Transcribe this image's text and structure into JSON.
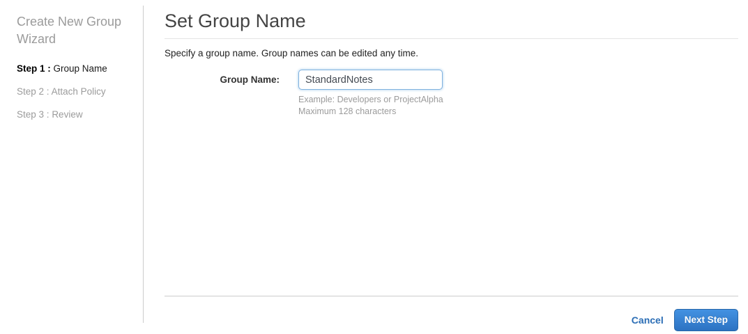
{
  "sidebar": {
    "title": "Create New Group Wizard",
    "steps": [
      {
        "prefix": "Step 1 :",
        "label": "Group Name",
        "active": true
      },
      {
        "prefix": "Step 2 :",
        "label": "Attach Policy",
        "active": false
      },
      {
        "prefix": "Step 3 :",
        "label": "Review",
        "active": false
      }
    ]
  },
  "main": {
    "title": "Set Group Name",
    "description": "Specify a group name. Group names can be edited any time.",
    "form": {
      "label": "Group Name:",
      "value": "StandardNotes",
      "hint_example": "Example: Developers or ProjectAlpha",
      "hint_max": "Maximum 128 characters"
    },
    "footer": {
      "cancel_label": "Cancel",
      "next_label": "Next Step"
    }
  },
  "colors": {
    "button_blue_top": "#4392e2",
    "button_blue_bottom": "#2c72c2",
    "link_blue": "#2a6db5",
    "input_focus_border": "#7fb1de",
    "muted_gray": "#9b9b9b"
  }
}
